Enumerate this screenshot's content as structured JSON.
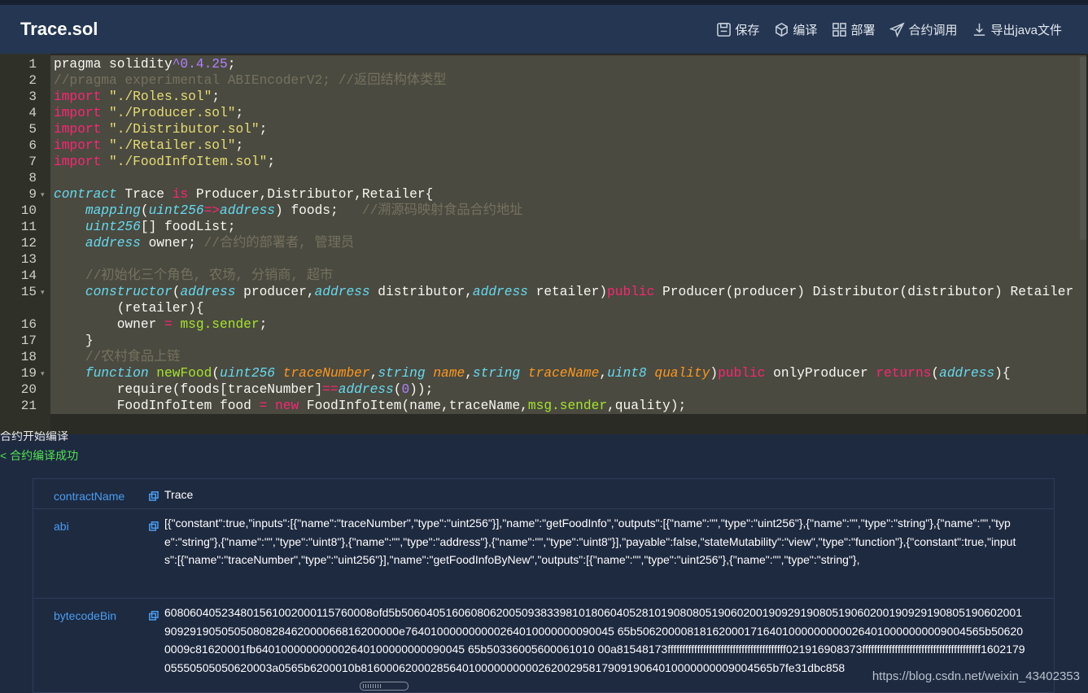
{
  "title": "Trace.sol",
  "toolbar": {
    "save": "保存",
    "compile": "编译",
    "deploy": "部署",
    "invoke": "合约调用",
    "export": "导出java文件"
  },
  "editor": {
    "line_numbers": [
      "1",
      "2",
      "3",
      "4",
      "5",
      "6",
      "7",
      "8",
      "9",
      "10",
      "11",
      "12",
      "13",
      "14",
      "15",
      "16",
      "17",
      "18",
      "19",
      "20",
      "21"
    ],
    "lines": {
      "l1a": "pragma solidity",
      "l1b": "^0.4.25",
      "l1c": ";",
      "l2": "//pragma experimental ABIEncoderV2; //返回结构体类型",
      "l3k": "import",
      "l3s": "\"./Roles.sol\"",
      "l3e": ";",
      "l4k": "import",
      "l4s": "\"./Producer.sol\"",
      "l4e": ";",
      "l5k": "import",
      "l5s": "\"./Distributor.sol\"",
      "l5e": ";",
      "l6k": "import",
      "l6s": "\"./Retailer.sol\"",
      "l6e": ";",
      "l7k": "import",
      "l7s": "\"./FoodInfoItem.sol\"",
      "l7e": ";",
      "l9a": "contract",
      "l9b": " Trace ",
      "l9c": "is",
      "l9d": " Producer,Distributor,Retailer{",
      "l10a": "mapping",
      "l10b": "(",
      "l10c": "uint256",
      "l10d": "=>",
      "l10e": "address",
      "l10f": ") foods;   ",
      "l10g": "//溯源码映射食品合约地址",
      "l11a": "uint256",
      "l11b": "[] foodList;",
      "l12a": "address",
      "l12b": " owner; ",
      "l12c": "//合约的部署者, 管理员",
      "l14": "//初始化三个角色, 农场, 分销商, 超市",
      "l15a": "constructor",
      "l15b": "(",
      "l15c": "address",
      "l15d": " producer,",
      "l15e": "address",
      "l15f": " distributor,",
      "l15g": "address",
      "l15h": " retailer)",
      "l15i": "public",
      "l15j": " Producer(producer) Distributor(distributor) Retailer",
      "l15w": "(retailer){",
      "l16a": "owner ",
      "l16b": "=",
      "l16c": " ",
      "l16d": "msg.sender",
      "l16e": ";",
      "l17": "}",
      "l18": "//农村食品上链",
      "l19a": "function",
      "l19b": " ",
      "l19c": "newFood",
      "l19d": "(",
      "l19e": "uint256",
      "l19f": " ",
      "l19g": "traceNumber",
      "l19h": ",",
      "l19i": "string",
      "l19j": " ",
      "l19k": "name",
      "l19l": ",",
      "l19m": "string",
      "l19n": " ",
      "l19o": "traceName",
      "l19p": ",",
      "l19q": "uint8",
      "l19r": " ",
      "l19s": "quality",
      "l19t": ")",
      "l19u": "public",
      "l19v": " onlyProducer ",
      "l19w": "returns",
      "l19x": "(",
      "l19y": "address",
      "l19z": "){",
      "l20a": "require(foods[traceNumber]",
      "l20b": "==",
      "l20c": "address",
      "l20d": "(",
      "l20e": "0",
      "l20f": "));",
      "l21a": "FoodInfoItem food ",
      "l21b": "=",
      "l21c": " ",
      "l21d": "new",
      "l21e": " FoodInfoItem(name,traceName,",
      "l21f": "msg.sender",
      "l21g": ",quality);"
    }
  },
  "console": {
    "log1": "合约开始编译",
    "log2": "< 合约编译成功"
  },
  "result": {
    "rows": [
      {
        "key": "contractName",
        "value": "Trace"
      },
      {
        "key": "abi",
        "value": "[{\"constant\":true,\"inputs\":[{\"name\":\"traceNumber\",\"type\":\"uint256\"}],\"name\":\"getFoodInfo\",\"outputs\":[{\"name\":\"\",\"type\":\"uint256\"},{\"name\":\"\",\"type\":\"string\"},{\"name\":\"\",\"type\":\"string\"},{\"name\":\"\",\"type\":\"uint8\"},{\"name\":\"\",\"type\":\"address\"},{\"name\":\"\",\"type\":\"uint8\"}],\"payable\":false,\"stateMutability\":\"view\",\"type\":\"function\"},{\"constant\":true,\"inputs\":[{\"name\":\"traceNumber\",\"type\":\"uint256\"}],\"name\":\"getFoodInfoByNew\",\"outputs\":[{\"name\":\"\",\"type\":\"uint256\"},{\"name\":\"\",\"type\":\"string\"},"
      },
      {
        "key": "bytecodeBin",
        "value": "608060405234801561002000115760008ofd5b506040516060806200509383398101806040528101908080519060200190929190805190602001909291908051906020019092919050505080828462000066816200000e764010000000000264010000000090045 65b5062000081816200017164010000000000264010000000009004565b506200009c81620001fb640100000000002640100000000090045 65b50336005600061010 00a81548173ffffffffffffffffffffffffffffffffffffffff021916908373ffffffffffffffffffffffffffffffffffffffff160217905550505050620003a0565b6200010b81600062000285640100000000002620029581790919064010000000009004565b7fe31dbc858"
      }
    ]
  },
  "watermark": "https://blog.csdn.net/weixin_43402353"
}
